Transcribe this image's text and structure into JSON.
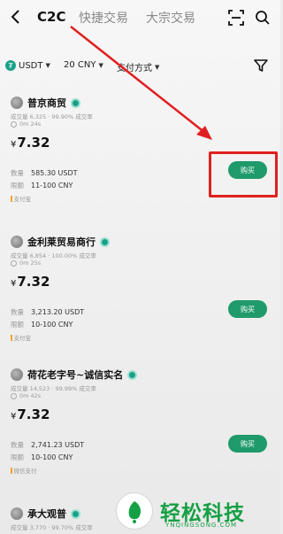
{
  "header": {
    "tabs": [
      {
        "label": "C2C",
        "active": true
      },
      {
        "label": "快捷交易",
        "active": false
      },
      {
        "label": "大宗交易",
        "active": false
      }
    ]
  },
  "filters": {
    "currency": "USDT",
    "amount": "20 CNY",
    "payment": "支付方式"
  },
  "listings": [
    {
      "merchant": "普京商贸",
      "stats": "成交量 6,325 · 99.90% 成交率",
      "time": "0m 24s",
      "price_symbol": "¥",
      "price": "7.32",
      "qty_label": "数量",
      "qty": "585.30 USDT",
      "limit_label": "限额",
      "limit": "11-100 CNY",
      "payment": "支付宝",
      "buy_label": "购买"
    },
    {
      "merchant": "金利莱贸易商行",
      "stats": "成交量 6,854 · 100.00% 成交率",
      "time": "0m 25s",
      "price_symbol": "¥",
      "price": "7.32",
      "qty_label": "数量",
      "qty": "3,213.20 USDT",
      "limit_label": "限额",
      "limit": "10-100 CNY",
      "payment": "支付宝",
      "buy_label": "购买"
    },
    {
      "merchant": "荷花老字号~诚信实名",
      "stats": "成交量 14,523 · 99.99% 成交率",
      "time": "0m 42s",
      "price_symbol": "¥",
      "price": "7.32",
      "qty_label": "数量",
      "qty": "2,741.23 USDT",
      "limit_label": "限额",
      "limit": "10-100 CNY",
      "payment": "微信支付",
      "buy_label": "购买"
    },
    {
      "merchant": "承大观普",
      "stats": "成交量 3,770 · 99.70% 成交率"
    }
  ],
  "watermark": {
    "brand": "轻松科技",
    "url": "YNQINGSONG.COM"
  },
  "colors": {
    "buy_button": "#1f9a6b",
    "highlight": "#e02020",
    "watermark": "#14a043"
  }
}
